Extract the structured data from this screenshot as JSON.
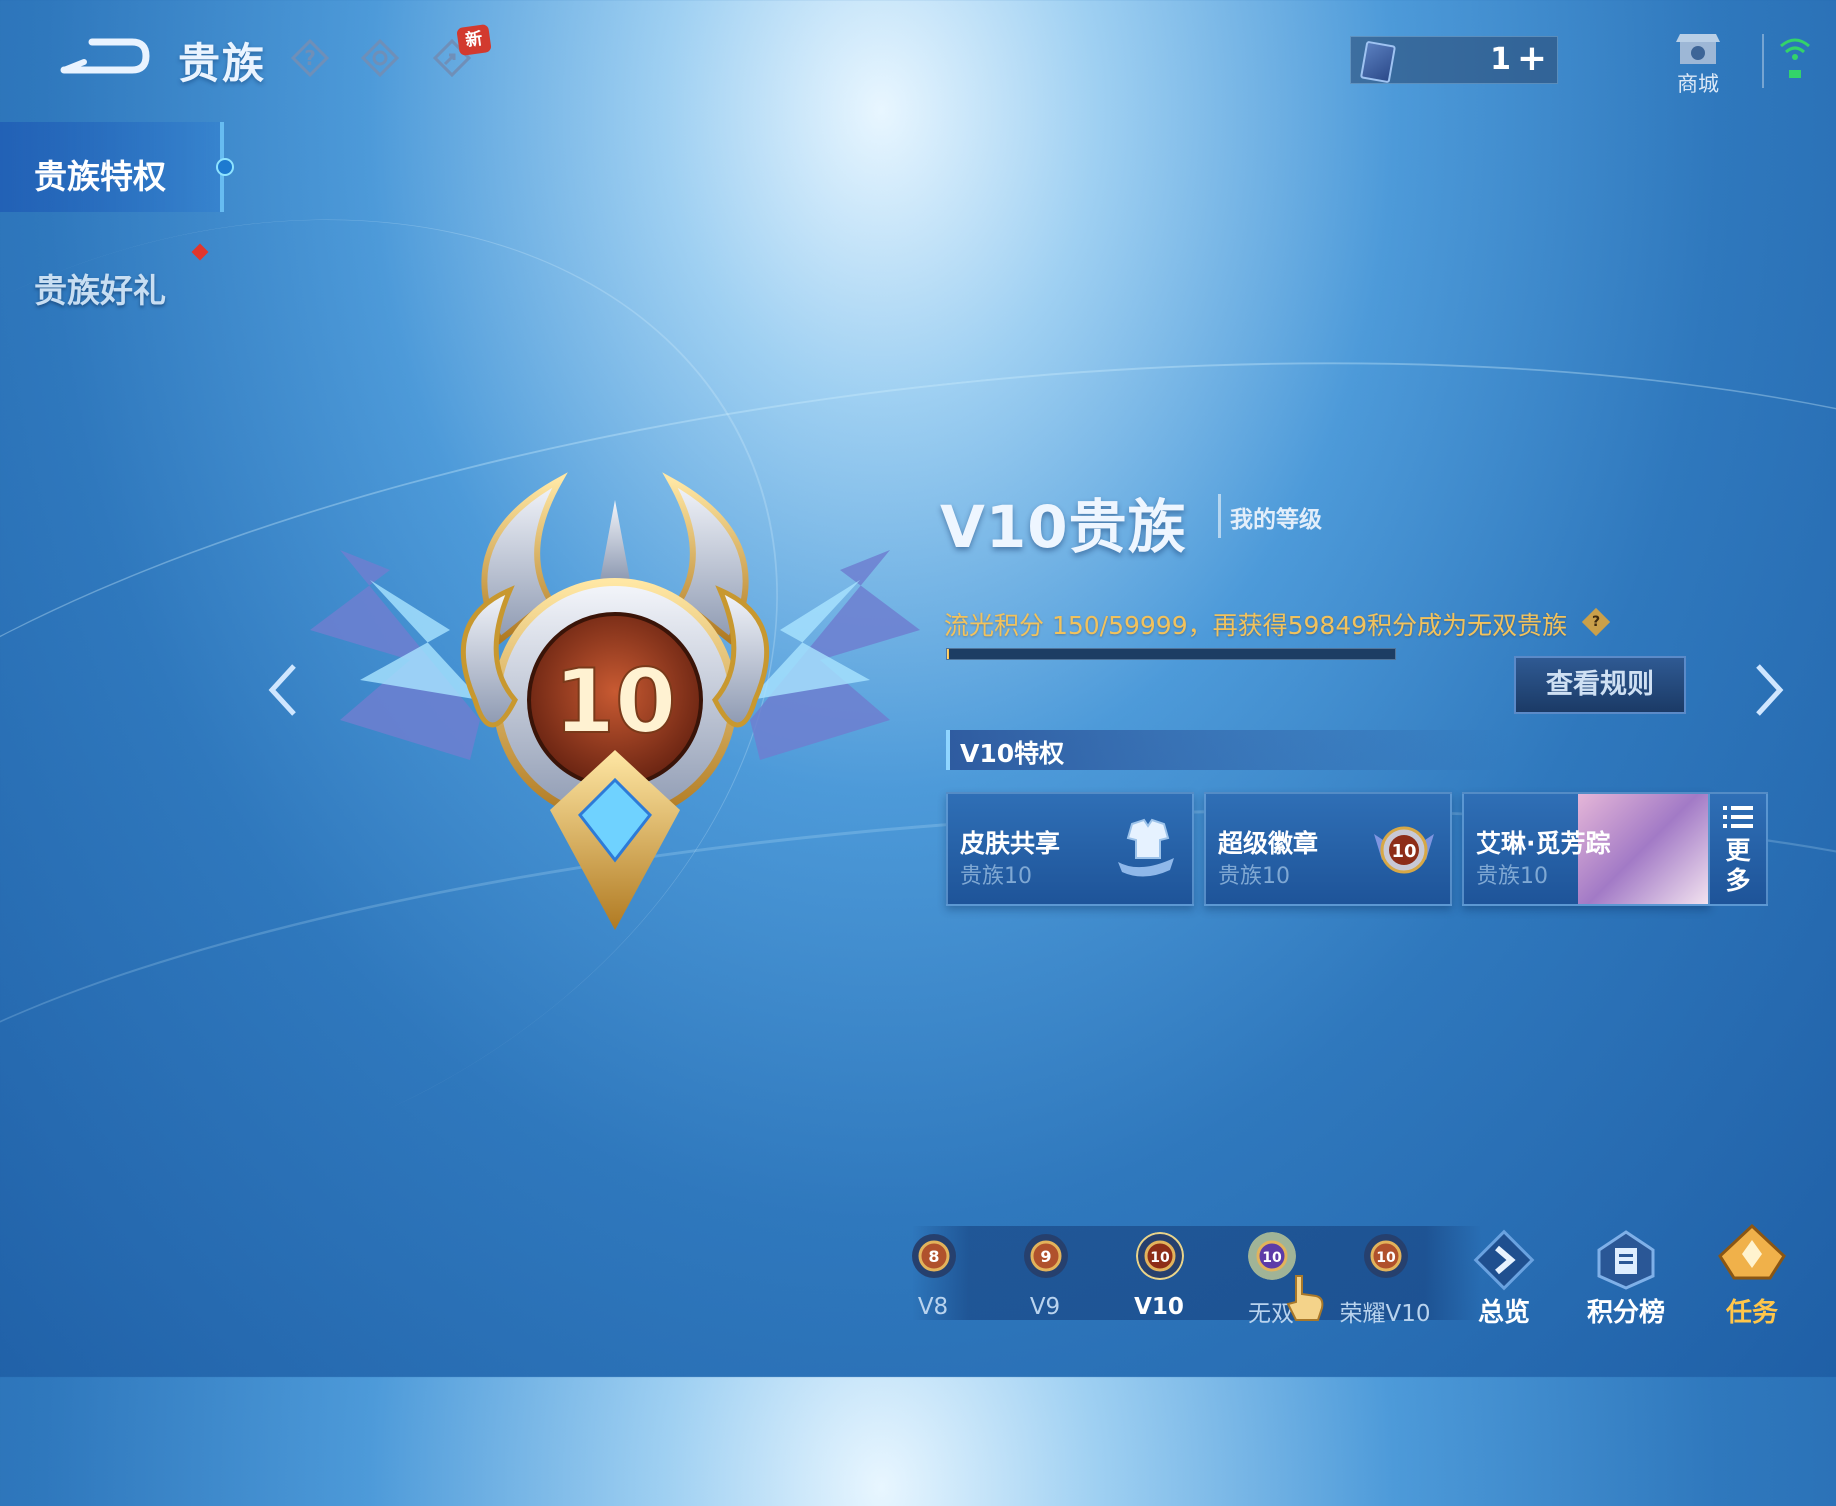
{
  "header": {
    "title": "贵族",
    "new_badge": "新",
    "currency_value": "1",
    "currency_add": "+",
    "shop_label": "商城"
  },
  "sidebar": {
    "items": [
      {
        "label": "贵族特权"
      },
      {
        "label": "贵族好礼"
      }
    ]
  },
  "emblem": {
    "level_number": "10"
  },
  "info": {
    "rank_title": "V10贵族",
    "my_level_label": "我的等级",
    "points_text": "流光积分 150/59999，再获得59849积分成为无双贵族",
    "progress": 0.0025,
    "help_mark": "?",
    "rules_button": "查看规则"
  },
  "privileges": {
    "header": "V10特权",
    "items": [
      {
        "name": "皮肤共享",
        "sub": "贵族10",
        "icon": "shirt-share-icon"
      },
      {
        "name": "超级徽章",
        "sub": "贵族10",
        "icon": "badge-10-icon"
      },
      {
        "name": "艾琳·觅芳踪",
        "sub": "贵族10",
        "icon": "skin-portrait-icon"
      }
    ],
    "more_label_1": "更",
    "more_label_2": "多"
  },
  "levels": {
    "items": [
      {
        "label": "V8",
        "num": "8"
      },
      {
        "label": "V9",
        "num": "9"
      },
      {
        "label": "V10",
        "num": "10"
      },
      {
        "label": "无双",
        "num": "10"
      },
      {
        "label": "荣耀V10",
        "num": "10"
      }
    ]
  },
  "bottom_nav": {
    "overview": "总览",
    "leaderboard": "积分榜",
    "tasks": "任务"
  },
  "colors": {
    "accent_gold": "#f2c25c",
    "panel_blue": "#1e5499"
  }
}
